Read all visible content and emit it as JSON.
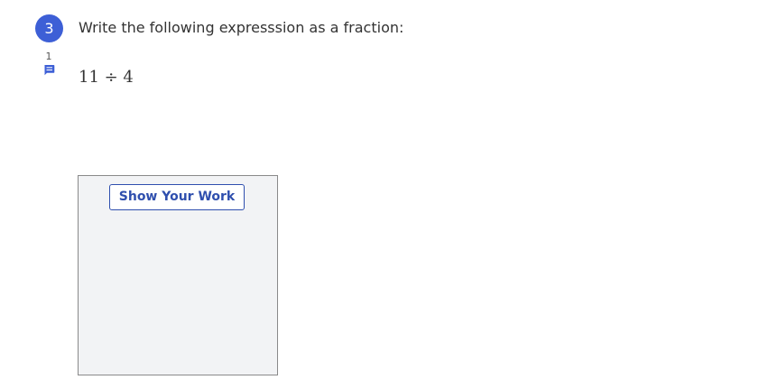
{
  "question": {
    "number": "3",
    "comment_count": "1",
    "comment_icon": "comment-icon",
    "prompt": "Write the following expresssion as a fraction:",
    "expression": "11 ÷ 4"
  },
  "work_area": {
    "button_label": "Show Your Work"
  },
  "colors": {
    "accent": "#3d5fd6",
    "button_text": "#2f4fae",
    "work_area_bg": "#f2f3f5"
  }
}
